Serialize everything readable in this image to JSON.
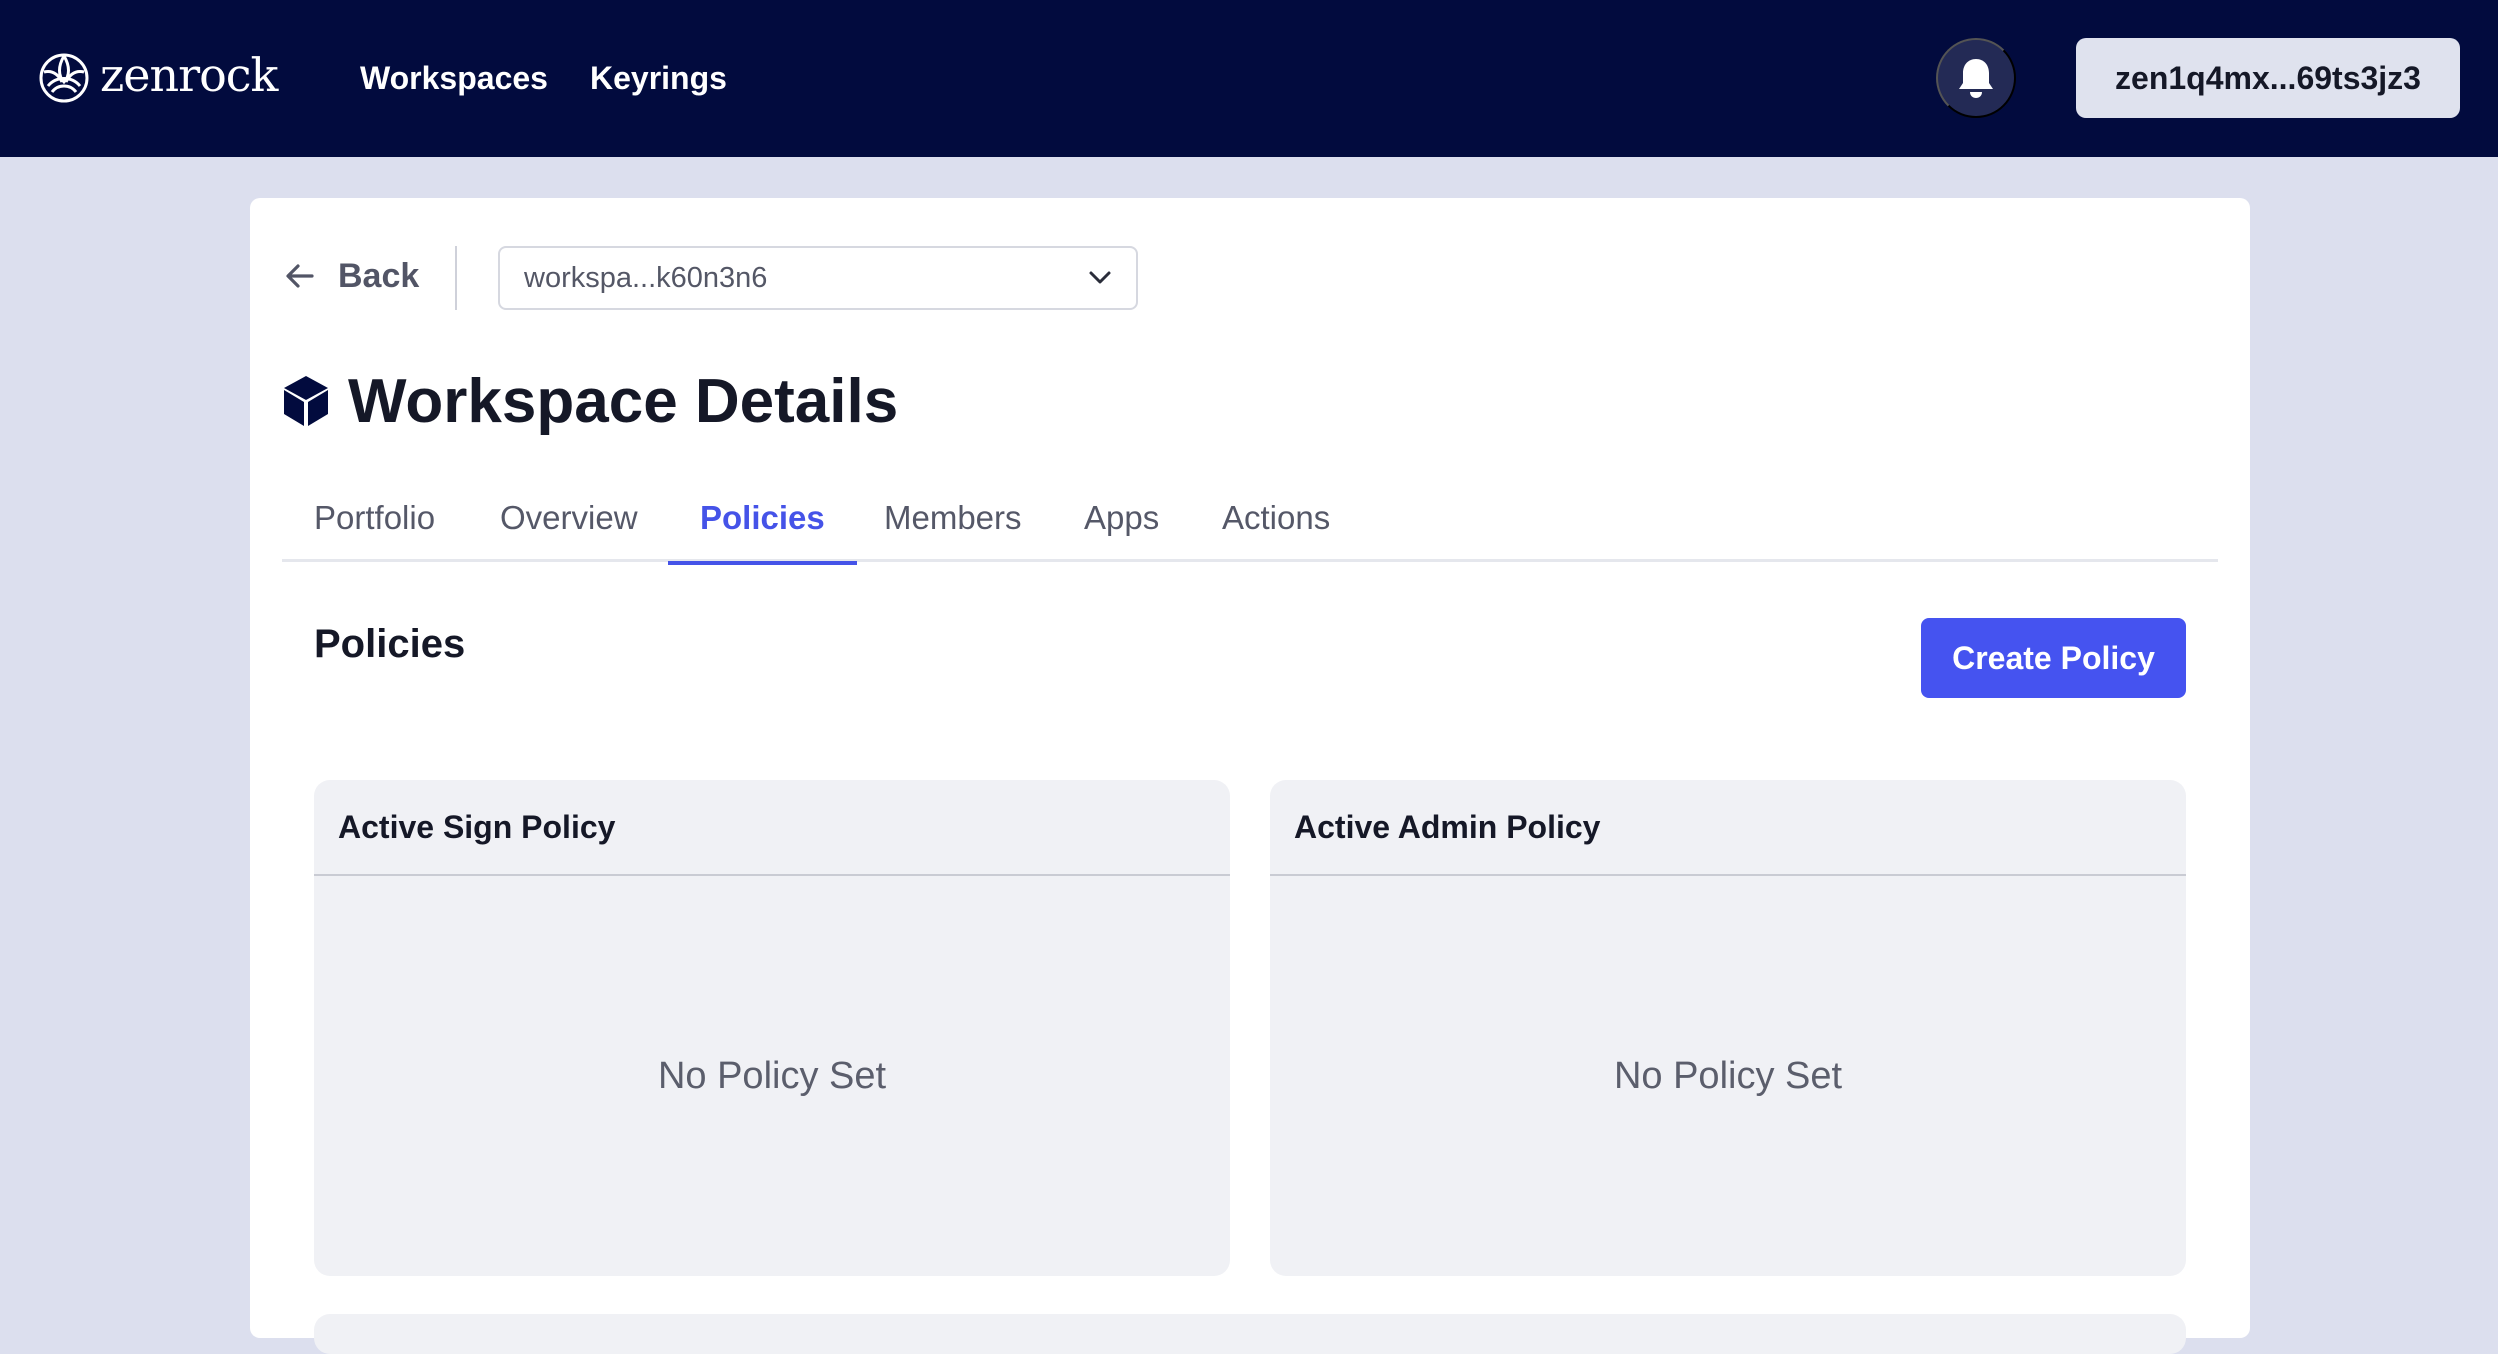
{
  "brand": {
    "name": "zenrock"
  },
  "nav": {
    "links": [
      "Workspaces",
      "Keyrings"
    ],
    "address": "zen1q4mx...69ts3jz3"
  },
  "toolbar": {
    "back_label": "Back",
    "workspace_select": "workspa...k60n3n6"
  },
  "page": {
    "title": "Workspace Details",
    "tabs": [
      {
        "label": "Portfolio",
        "active": false
      },
      {
        "label": "Overview",
        "active": false
      },
      {
        "label": "Policies",
        "active": true
      },
      {
        "label": "Members",
        "active": false
      },
      {
        "label": "Apps",
        "active": false
      },
      {
        "label": "Actions",
        "active": false
      }
    ]
  },
  "policies": {
    "section_title": "Policies",
    "create_label": "Create Policy",
    "sign": {
      "title": "Active Sign Policy",
      "empty_text": "No Policy Set"
    },
    "admin": {
      "title": "Active Admin Policy",
      "empty_text": "No Policy Set"
    }
  },
  "colors": {
    "navbar": "#020b3e",
    "accent": "#4553f0",
    "page_bg": "#dcdfee"
  }
}
